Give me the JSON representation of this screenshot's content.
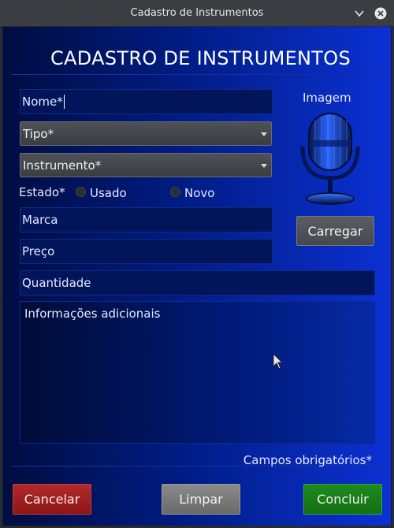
{
  "window": {
    "title": "Cadastro de Instrumentos"
  },
  "header": {
    "title": "CADASTRO DE INSTRUMENTOS"
  },
  "form": {
    "nome_placeholder": "Nome*",
    "tipo_value": "Tipo*",
    "instrumento_value": "Instrumento*",
    "estado_label": "Estado*",
    "estado_options": [
      "Usado",
      "Novo"
    ],
    "marca_placeholder": "Marca",
    "preco_placeholder": "Preço",
    "quantidade_placeholder": "Quantidade",
    "info_placeholder": "Informações adicionais",
    "required_note": "Campos obrigatórios*"
  },
  "image": {
    "label": "Imagem",
    "load_button": "Carregar",
    "icon": "microphone-icon"
  },
  "actions": {
    "cancel": "Cancelar",
    "clear": "Limpar",
    "confirm": "Concluir"
  },
  "colors": {
    "background_dark": "#000d40",
    "background_bright": "#0b31d4",
    "cancel": "#b22a2a",
    "clear": "#8a8a8a",
    "confirm": "#1e8a1e"
  }
}
